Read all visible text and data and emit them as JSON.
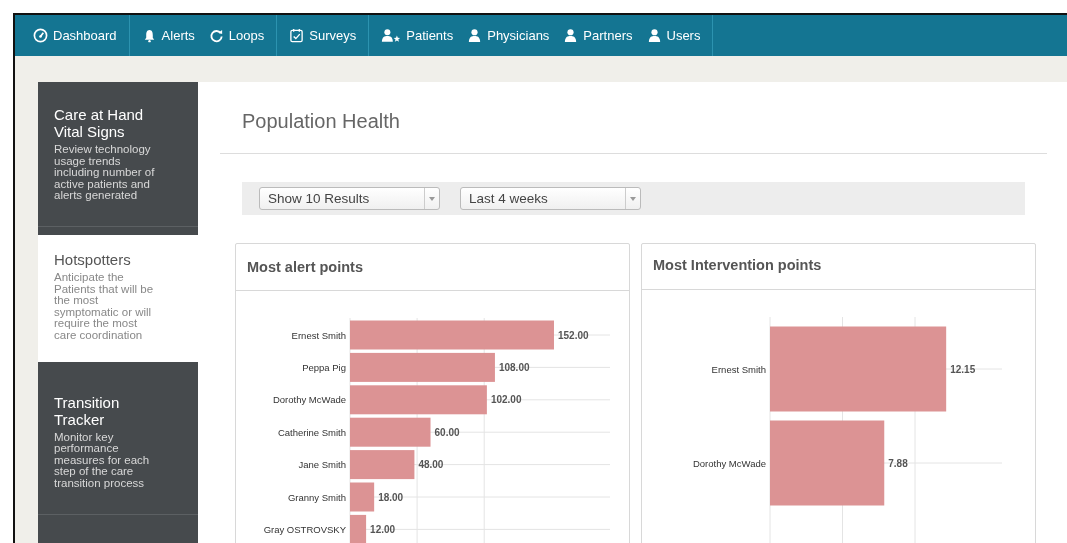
{
  "nav": {
    "groups": [
      [
        {
          "label": "Dashboard"
        }
      ],
      [
        {
          "label": "Alerts"
        },
        {
          "label": "Loops"
        }
      ],
      [
        {
          "label": "Surveys"
        }
      ],
      [
        {
          "label": "Patients"
        },
        {
          "label": "Physicians"
        },
        {
          "label": "Partners"
        },
        {
          "label": "Users"
        }
      ]
    ]
  },
  "sidebar": {
    "items": [
      {
        "title": "Care at Hand Vital Signs",
        "description": "Review technology usage trends including number of active patients and alerts generated",
        "selected": false
      },
      {
        "title": "Hotspotters",
        "description": "Anticipate the Patients that will be the most symptomatic or will require the most care coordination",
        "selected": true
      },
      {
        "title": "Transition Tracker",
        "description": "Monitor key performance measures for each step of the care transition process",
        "selected": false
      }
    ]
  },
  "page": {
    "title": "Population Health"
  },
  "filters": [
    {
      "value": "Show 10 Results"
    },
    {
      "value": "Last 4 weeks"
    }
  ],
  "panels": [
    {
      "title": "Most alert points",
      "chart_data": {
        "type": "bar",
        "orientation": "horizontal",
        "categories": [
          "Ernest Smith",
          "Peppa Pig",
          "Dorothy McWade",
          "Catherine Smith",
          "Jane Smith",
          "Granny Smith",
          "Gray OSTROVSKY"
        ],
        "values": [
          152,
          108,
          102,
          60,
          48,
          18,
          12
        ],
        "value_labels": [
          "152.00",
          "108.00",
          "102.00",
          "60.00",
          "48.00",
          "18.00",
          "12.00"
        ]
      }
    },
    {
      "title": "Most Intervention points",
      "chart_data": {
        "type": "bar",
        "orientation": "horizontal",
        "categories": [
          "Ernest Smith",
          "Dorothy McWade"
        ],
        "values": [
          12.15,
          7.88
        ],
        "value_labels": [
          "12.15",
          "7.88"
        ]
      }
    }
  ]
}
